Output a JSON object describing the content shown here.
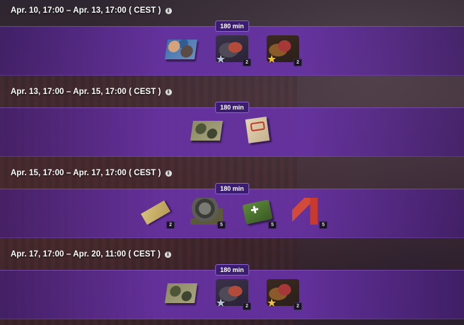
{
  "schedule": [
    {
      "date_range": "Apr. 10, 17:00 – Apr. 13, 17:00 ( CEST )",
      "duration": "180 min",
      "rewards": [
        {
          "icon": "blue-camouflage",
          "qty": ""
        },
        {
          "icon": "tank-crew-silver-star",
          "qty": "2"
        },
        {
          "icon": "crew-gold-star",
          "qty": "2"
        }
      ]
    },
    {
      "date_range": "Apr. 13, 17:00 – Apr. 15, 17:00 ( CEST )",
      "duration": "180 min",
      "rewards": [
        {
          "icon": "green-camouflage",
          "qty": ""
        },
        {
          "icon": "documents-papers",
          "qty": ""
        }
      ]
    },
    {
      "date_range": "Apr. 15, 17:00 – Apr. 17, 17:00 ( CEST )",
      "duration": "180 min",
      "rewards": [
        {
          "icon": "gold-ticket",
          "qty": "2"
        },
        {
          "icon": "tank-equipment-gear",
          "qty": "5"
        },
        {
          "icon": "medkit",
          "qty": "5"
        },
        {
          "icon": "fire-extinguisher",
          "qty": "5"
        }
      ]
    },
    {
      "date_range": "Apr. 17, 17:00 – Apr. 20, 11:00 ( CEST )",
      "duration": "180 min",
      "rewards": [
        {
          "icon": "green-camouflage",
          "qty": ""
        },
        {
          "icon": "tank-crew-silver-star",
          "qty": "2"
        },
        {
          "icon": "crew-gold-star",
          "qty": "2"
        }
      ]
    }
  ],
  "colors": {
    "band": "#6932aa",
    "badge_bg": "#3a1d6e",
    "badge_border": "#8d64d4"
  }
}
